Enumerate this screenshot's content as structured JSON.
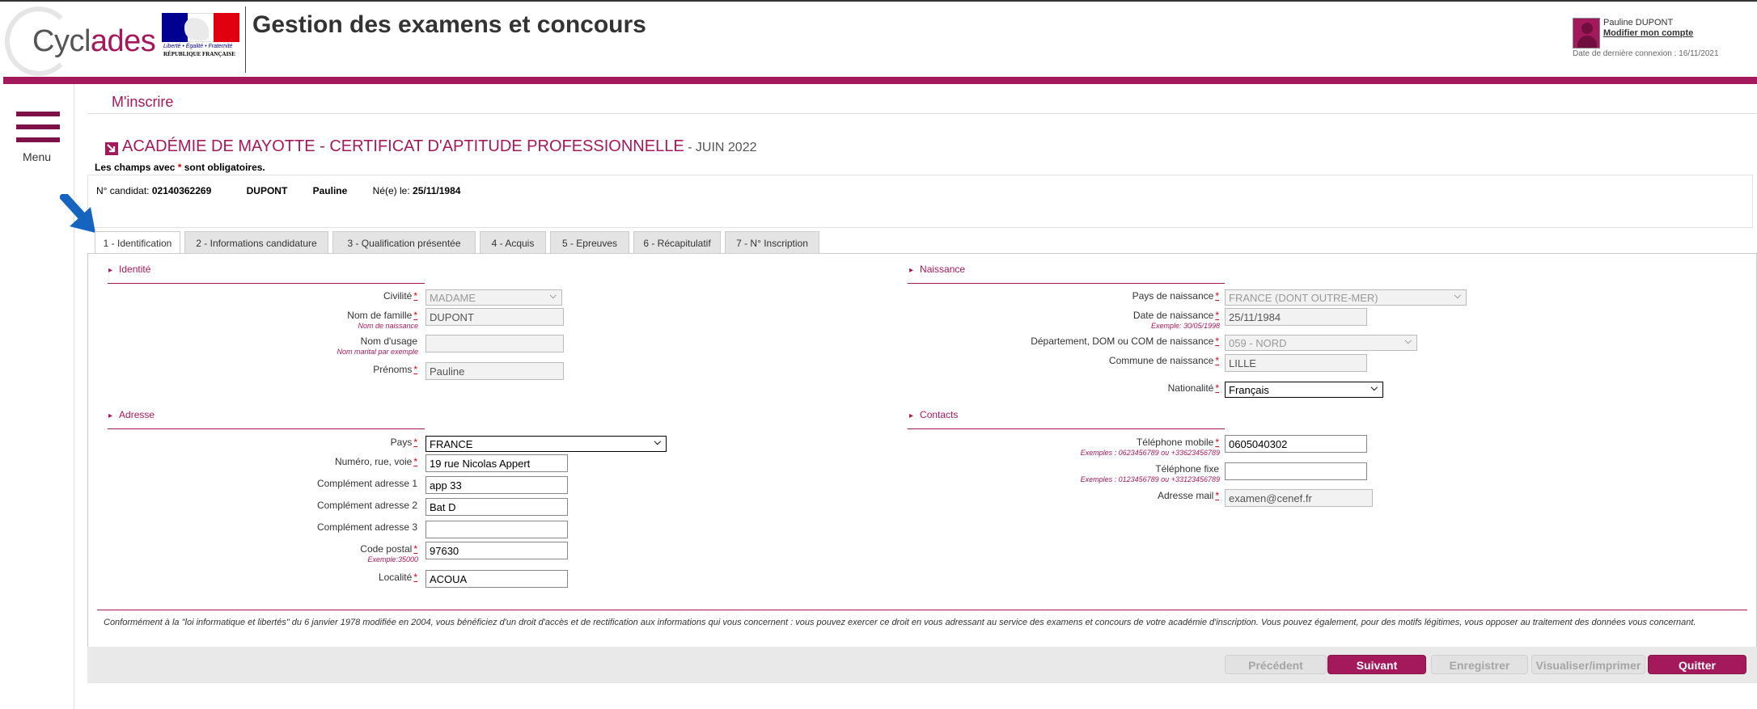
{
  "header": {
    "logo_text_a": "Cycl",
    "logo_text_b": "ades",
    "marianne_motto": "Liberté • Égalité • Fraternité",
    "marianne_rf": "RÉPUBLIQUE FRANÇAISE",
    "app_title": "Gestion des examens et concours",
    "user_name": "Pauline DUPONT",
    "account_link": "Modifier mon compte",
    "last_connection": "Date de dernière connexion : 16/11/2021"
  },
  "sidebar": {
    "menu_label": "Menu"
  },
  "main": {
    "breadcrumb": "M'inscrire",
    "exam_title": "ACADÉMIE DE MAYOTTE - CERTIFICAT D'APTITUDE PROFESSIONNELLE",
    "exam_session": " - JUIN 2022",
    "mandatory_a": "Les champs avec ",
    "mandatory_star": "*",
    "mandatory_b": " sont obligatoires.",
    "candidate": {
      "num_label": "N° candidat: ",
      "num_value": "02140362269",
      "last_name": "DUPONT",
      "first_name": "Pauline",
      "birth_label": "Né(e) le: ",
      "birth_value": "25/11/1984"
    }
  },
  "tabs": [
    "1 - Identification",
    "2 - Informations candidature",
    "3 - Qualification présentée",
    "4 - Acquis",
    "5 - Epreuves",
    "6 - Récapitulatif",
    "7 - N° Inscription"
  ],
  "identite": {
    "title": "Identité",
    "civilite_label": "Civilité",
    "civilite_value": "MADAME",
    "nom_label": "Nom de famille",
    "nom_hint": "Nom de naissance",
    "nom_value": "DUPONT",
    "usage_label": "Nom d'usage",
    "usage_hint": "Nom marital par exemple",
    "usage_value": "",
    "prenoms_label": "Prénoms",
    "prenoms_value": "Pauline"
  },
  "naissance": {
    "title": "Naissance",
    "pays_label": "Pays de naissance",
    "pays_value": "FRANCE (DONT OUTRE-MER)",
    "date_label": "Date de naissance",
    "date_hint": "Exemple: 30/05/1998",
    "date_value": "25/11/1984",
    "dept_label": "Département, DOM ou COM de naissance",
    "dept_value": "059 - NORD",
    "commune_label": "Commune de naissance",
    "commune_value": "LILLE",
    "nationalite_label": "Nationalité",
    "nationalite_value": "Français"
  },
  "adresse": {
    "title": "Adresse",
    "pays_label": "Pays",
    "pays_value": "FRANCE",
    "rue_label": "Numéro, rue, voie",
    "rue_value": "19 rue Nicolas Appert",
    "c1_label": "Complément adresse 1",
    "c1_value": "app 33",
    "c2_label": "Complément adresse 2",
    "c2_value": "Bat D",
    "c3_label": "Complément adresse 3",
    "c3_value": "",
    "cp_label": "Code postal",
    "cp_hint": "Exemple:35000",
    "cp_value": "97630",
    "localite_label": "Localité",
    "localite_value": "ACOUA"
  },
  "contacts": {
    "title": "Contacts",
    "mobile_label": "Téléphone mobile",
    "mobile_hint": "Exemples : 0623456789 ou +33623456789",
    "mobile_value": "0605040302",
    "fixe_label": "Téléphone fixe",
    "fixe_hint": "Exemples : 0123456789 ou +33123456789",
    "fixe_value": "",
    "mail_label": "Adresse mail",
    "mail_value": "examen@cenef.fr"
  },
  "required_mark": "*",
  "legal_text": "Conformément à la \"loi informatique et libertés\" du 6 janvier 1978 modifiée en 2004, vous bénéficiez d'un droit d'accès et de rectification aux informations qui vous concernent : vous pouvez exercer ce droit en vous adressant au service des examens et concours de votre académie d'inscription. Vous pouvez également, pour des motifs légitimes, vous opposer au traitement des données vous concernant.",
  "buttons": {
    "prev": "Précédent",
    "next": "Suivant",
    "save": "Enregistrer",
    "print": "Visualiser/imprimer",
    "quit": "Quitter"
  },
  "colors": {
    "brand": "#a3195b",
    "arrow": "#1565c0"
  }
}
